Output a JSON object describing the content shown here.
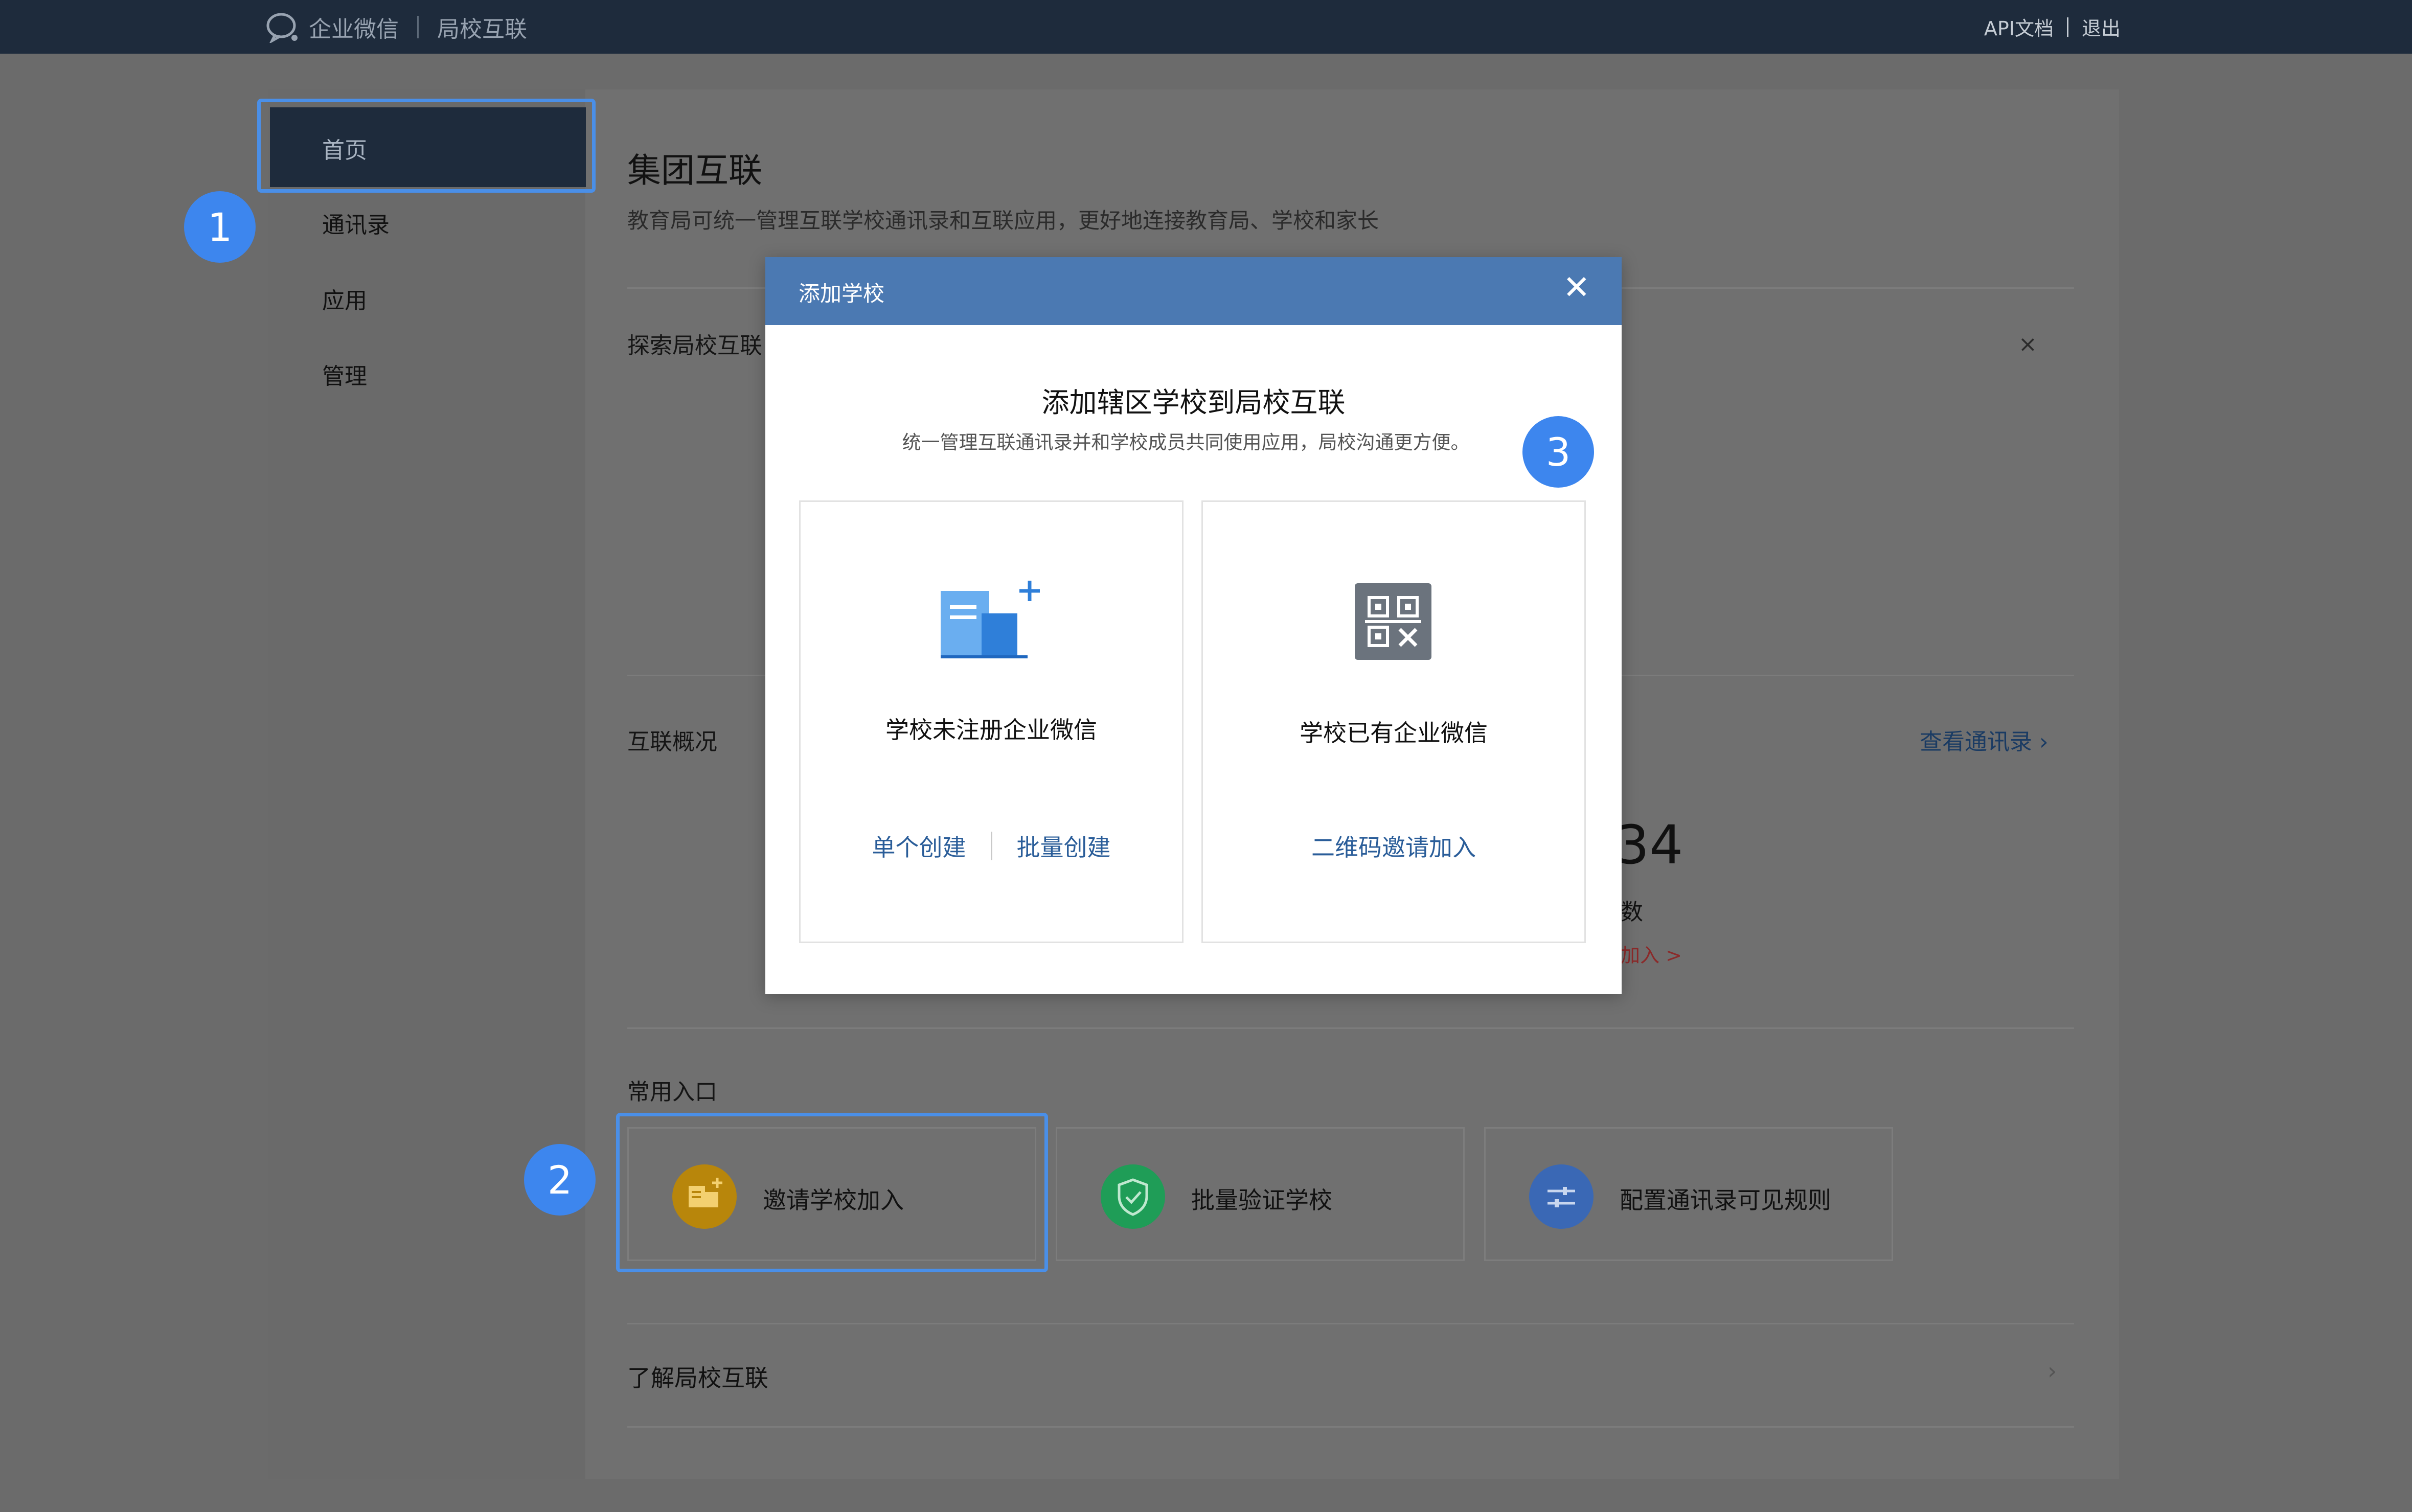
{
  "topbar": {
    "brand_name": "企业微信",
    "product_name": "局校互联",
    "api_docs": "API文档",
    "logout": "退出"
  },
  "sidebar": {
    "items": [
      {
        "label": "首页",
        "active": true
      },
      {
        "label": "通讯录"
      },
      {
        "label": "应用"
      },
      {
        "label": "管理"
      }
    ]
  },
  "main": {
    "title": "集团互联",
    "subtitle": "教育局可统一管理互联学校通讯录和互联应用，更好地连接教育局、学校和家长",
    "explore_label": "探索局校互联",
    "overview_label": "互联概况",
    "view_contacts": "查看通讯录 ›",
    "overview_number": "34",
    "overview_unit": "数",
    "overview_link": "加入 >",
    "entries_label": "常用入口",
    "entries": [
      {
        "label": "邀请学校加入",
        "icon": "invite-school-icon",
        "color": "#b8860b"
      },
      {
        "label": "批量验证学校",
        "icon": "shield-check-icon",
        "color": "#1f9d57"
      },
      {
        "label": "配置通讯录可见规则",
        "icon": "sliders-icon",
        "color": "#3a68b5"
      }
    ],
    "learn_more": "了解局校互联",
    "close_icon": "×"
  },
  "modal": {
    "title": "添加学校",
    "heading": "添加辖区学校到局校互联",
    "subheading": "统一管理互联通讯录并和学校成员共同使用应用，局校沟通更方便。",
    "card_unregistered": {
      "title": "学校未注册企业微信",
      "link_single": "单个创建",
      "link_batch": "批量创建"
    },
    "card_registered": {
      "title": "学校已有企业微信",
      "link_qr": "二维码邀请加入"
    }
  },
  "callouts": [
    "1",
    "2",
    "3"
  ],
  "colors": {
    "topbar": "#1e2b3c",
    "modal_header": "#4b79b2",
    "highlight": "#4a8fe8",
    "callout": "#3d86ee",
    "link": "#2a5d99"
  }
}
